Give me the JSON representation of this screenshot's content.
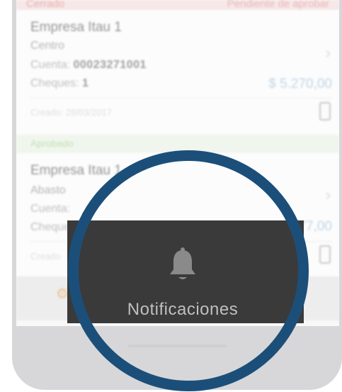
{
  "status_strip": {
    "left": "Cerrado",
    "right": "Pendiente de aprobar"
  },
  "cards": [
    {
      "company": "Empresa Itau 1",
      "branch": "Centro",
      "account_label": "Cuenta:",
      "account_number": "00023271001",
      "cheques_label": "Cheques:",
      "cheques_count": "1",
      "amount": "$ 5.270,00",
      "created": "Creado: 28/03/2017"
    },
    {
      "section": "Aprobado",
      "company": "Empresa Itau 1",
      "branch": "Abasto",
      "account_label": "Cuenta:",
      "cheques_label": "Cheques",
      "amount": "77,00",
      "created": "Creado"
    }
  ],
  "toast": {
    "label": "Notificaciones",
    "icon": "bell-icon"
  },
  "colors": {
    "ring": "#1b4f7a",
    "toast_bg": "#3a3a3a",
    "amount": "#9fc0de",
    "aprobado": "#9bcf8a"
  }
}
